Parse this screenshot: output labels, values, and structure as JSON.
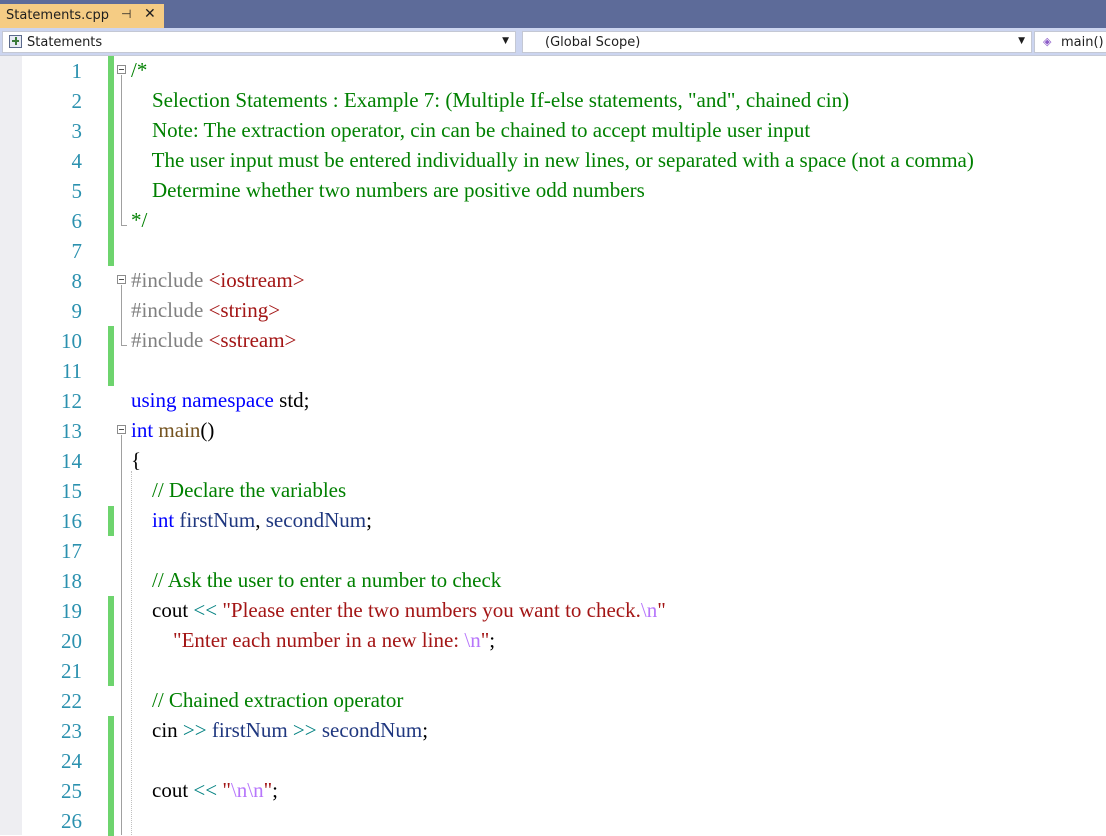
{
  "tab": {
    "filename": "Statements.cpp",
    "pin_glyph": "⊣",
    "close_glyph": "✕"
  },
  "navbar": {
    "project": "Statements",
    "scope": "(Global Scope)",
    "function": "main()",
    "icons": [
      "project-icon",
      "function-icon"
    ]
  },
  "colors": {
    "comment": "#008000",
    "preprocessor": "#808080",
    "string": "#a31515",
    "keyword": "#0000ff",
    "function": "#74531f",
    "variable": "#1f377f",
    "operator": "#008080",
    "escape": "#b776fb",
    "line_number": "#2b91af",
    "change_marker": "#6ed46e",
    "tab_active": "#f5cc84",
    "tabstrip": "#5d6b99"
  },
  "lines": [
    {
      "n": "1",
      "tokens": [
        [
          "cm",
          "/*"
        ]
      ]
    },
    {
      "n": "2",
      "tokens": [
        [
          "cm",
          "    Selection Statements : Example 7: (Multiple If-else statements, \"and\", chained cin)"
        ]
      ]
    },
    {
      "n": "3",
      "tokens": [
        [
          "cm",
          "    Note: The extraction operator, cin can be chained to accept multiple user input"
        ]
      ]
    },
    {
      "n": "4",
      "tokens": [
        [
          "cm",
          "    The user input must be entered individually in new lines, or separated with a space (not a comma)"
        ]
      ]
    },
    {
      "n": "5",
      "tokens": [
        [
          "cm",
          "    Determine whether two numbers are positive odd numbers"
        ]
      ]
    },
    {
      "n": "6",
      "tokens": [
        [
          "cm",
          "*/"
        ]
      ]
    },
    {
      "n": "7",
      "tokens": []
    },
    {
      "n": "8",
      "tokens": [
        [
          "pp",
          "#include "
        ],
        [
          "str",
          "<iostream>"
        ]
      ]
    },
    {
      "n": "9",
      "tokens": [
        [
          "pp",
          "#include "
        ],
        [
          "str",
          "<string>"
        ]
      ]
    },
    {
      "n": "10",
      "tokens": [
        [
          "pp",
          "#include "
        ],
        [
          "str",
          "<sstream>"
        ]
      ]
    },
    {
      "n": "11",
      "tokens": []
    },
    {
      "n": "12",
      "tokens": [
        [
          "kw",
          "using"
        ],
        [
          "",
          " "
        ],
        [
          "kw",
          "namespace"
        ],
        [
          "",
          " std;"
        ]
      ]
    },
    {
      "n": "13",
      "tokens": [
        [
          "kw",
          "int"
        ],
        [
          "",
          " "
        ],
        [
          "fn",
          "main"
        ],
        [
          "",
          "()"
        ]
      ]
    },
    {
      "n": "14",
      "tokens": [
        [
          "",
          "{"
        ]
      ]
    },
    {
      "n": "15",
      "tokens": [
        [
          "cm",
          "    // Declare the variables"
        ]
      ]
    },
    {
      "n": "16",
      "tokens": [
        [
          "",
          "    "
        ],
        [
          "kw",
          "int"
        ],
        [
          "",
          " "
        ],
        [
          "var",
          "firstNum"
        ],
        [
          "",
          ", "
        ],
        [
          "var",
          "secondNum"
        ],
        [
          "",
          ";"
        ]
      ]
    },
    {
      "n": "17",
      "tokens": []
    },
    {
      "n": "18",
      "tokens": [
        [
          "cm",
          "    // Ask the user to enter a number to check"
        ]
      ]
    },
    {
      "n": "19",
      "tokens": [
        [
          "",
          "    cout "
        ],
        [
          "op",
          "<<"
        ],
        [
          "",
          " "
        ],
        [
          "str",
          "\"Please enter the two numbers you want to check."
        ],
        [
          "esc",
          "\\n"
        ],
        [
          "str",
          "\""
        ]
      ]
    },
    {
      "n": "20",
      "tokens": [
        [
          "",
          "        "
        ],
        [
          "str",
          "\"Enter each number in a new line: "
        ],
        [
          "esc",
          "\\n"
        ],
        [
          "str",
          "\""
        ],
        [
          "",
          ";"
        ]
      ]
    },
    {
      "n": "21",
      "tokens": []
    },
    {
      "n": "22",
      "tokens": [
        [
          "cm",
          "    // Chained extraction operator"
        ]
      ]
    },
    {
      "n": "23",
      "tokens": [
        [
          "",
          "    cin "
        ],
        [
          "op",
          ">>"
        ],
        [
          "",
          " "
        ],
        [
          "var",
          "firstNum"
        ],
        [
          "",
          " "
        ],
        [
          "op",
          ">>"
        ],
        [
          "",
          " "
        ],
        [
          "var",
          "secondNum"
        ],
        [
          "",
          ";"
        ]
      ]
    },
    {
      "n": "24",
      "tokens": []
    },
    {
      "n": "25",
      "tokens": [
        [
          "",
          "    cout "
        ],
        [
          "op",
          "<<"
        ],
        [
          "",
          " "
        ],
        [
          "str",
          "\""
        ],
        [
          "esc",
          "\\n\\n"
        ],
        [
          "str",
          "\""
        ],
        [
          "",
          ";"
        ]
      ]
    },
    {
      "n": "26",
      "tokens": []
    }
  ]
}
